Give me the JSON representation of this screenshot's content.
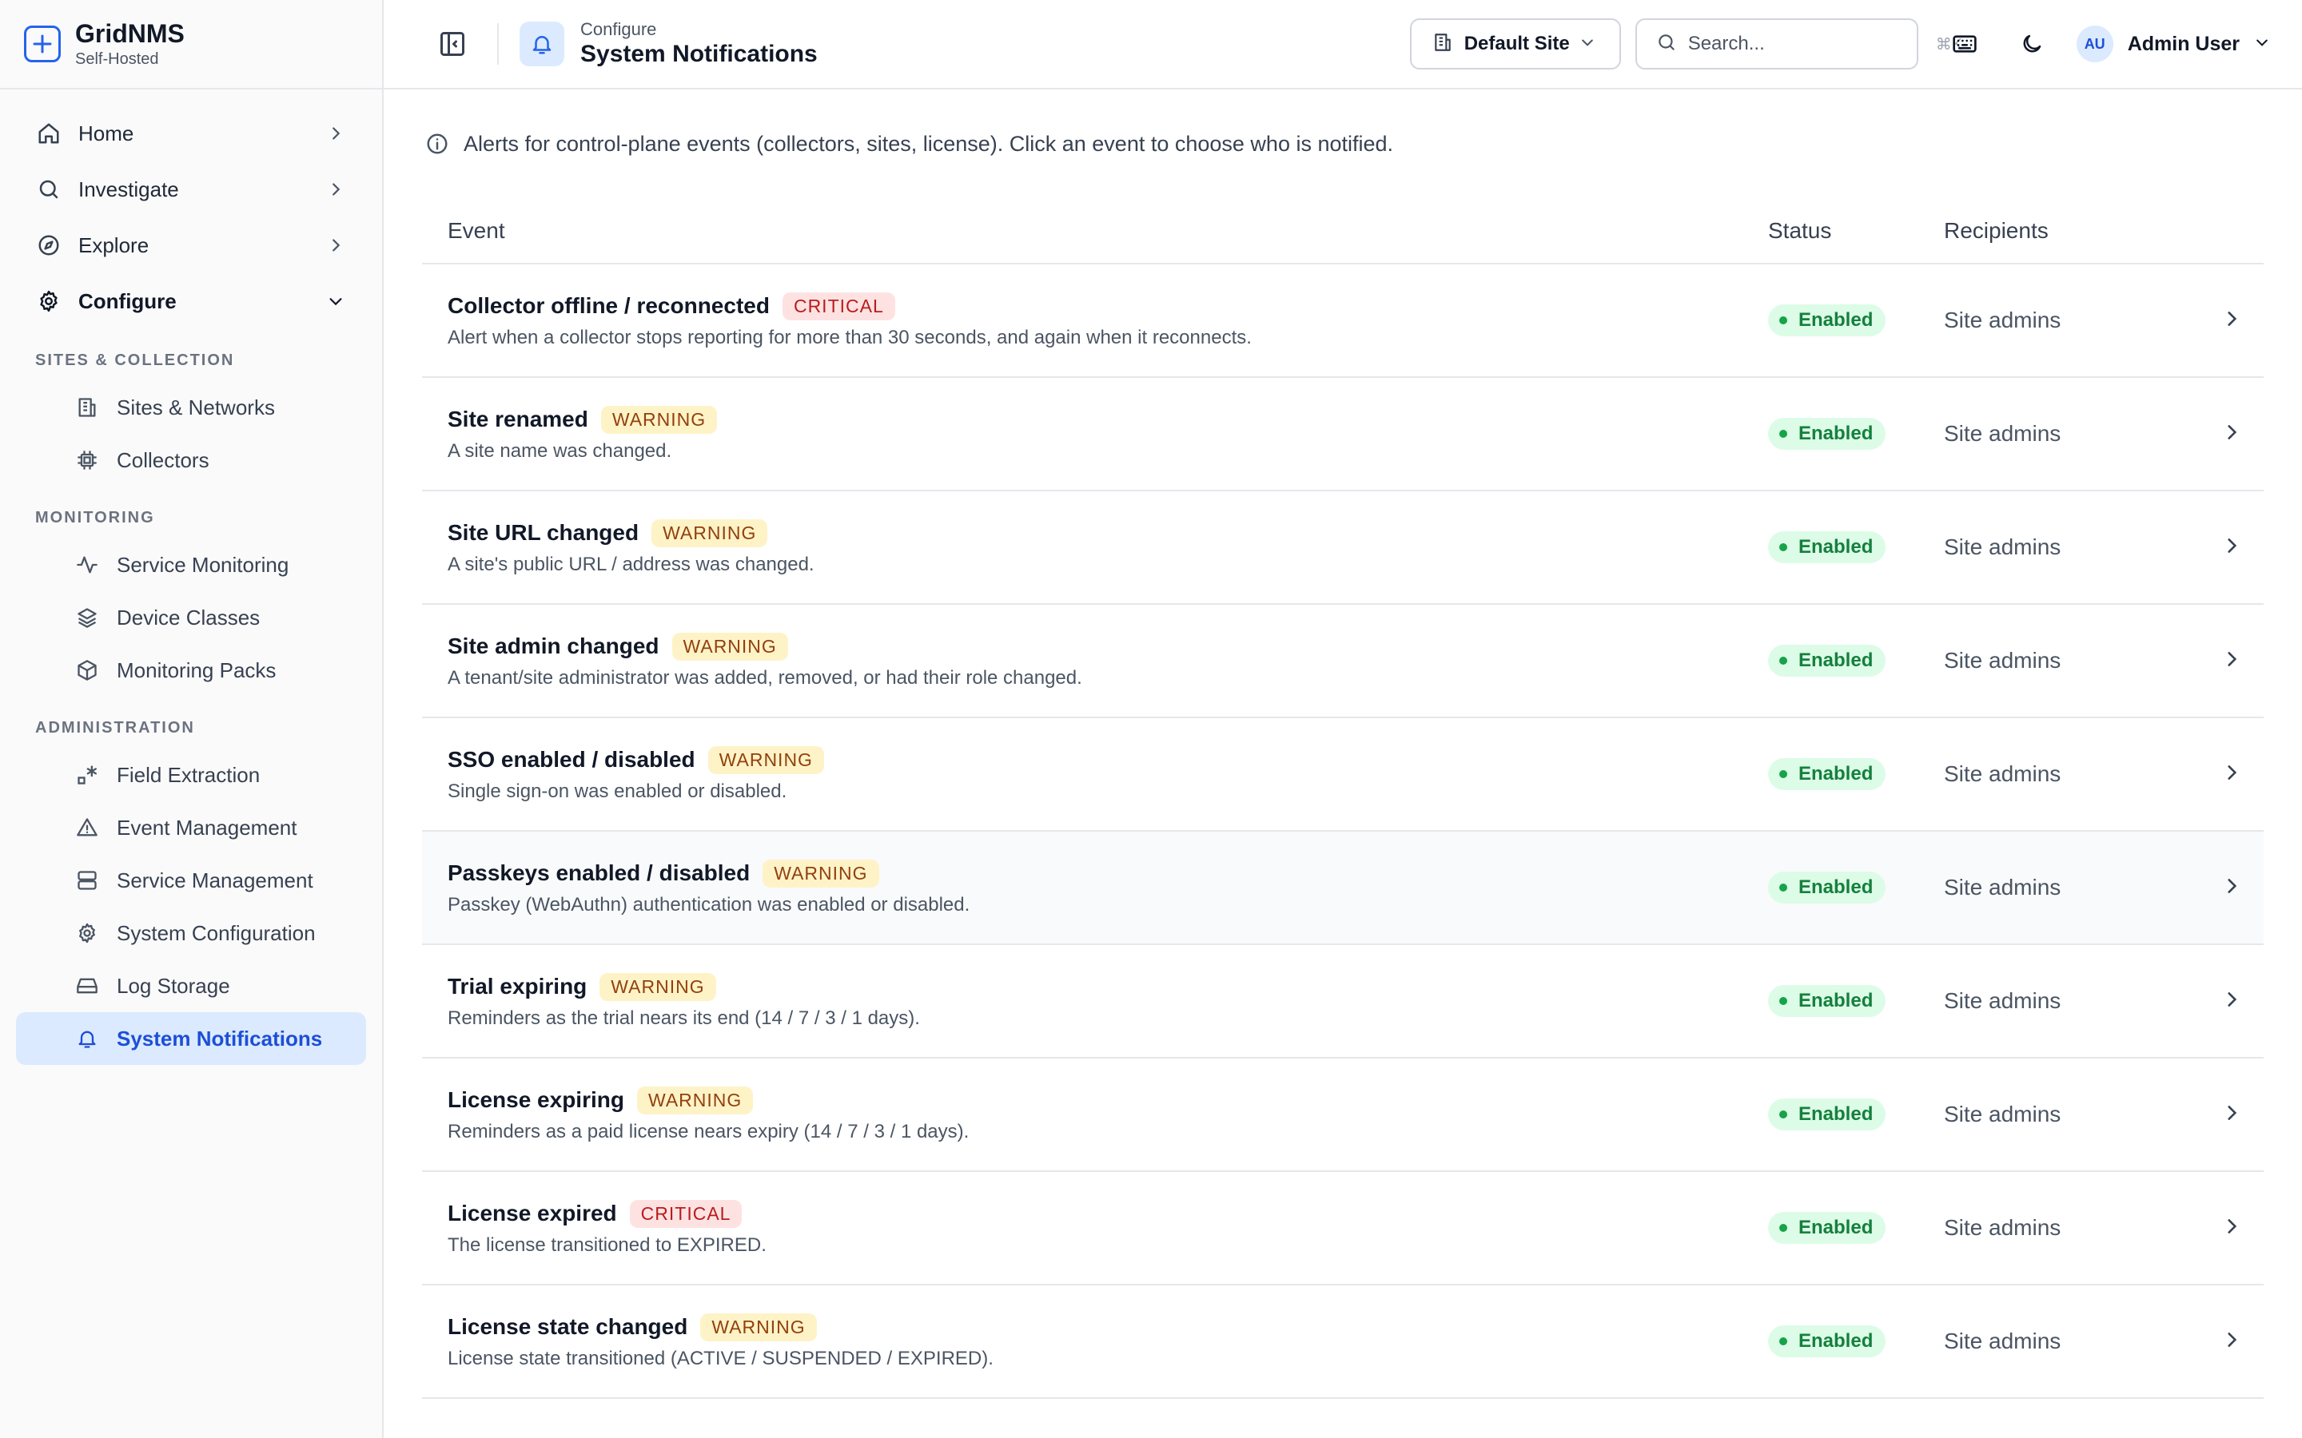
{
  "brand": {
    "name": "GridNMS",
    "sub": "Self-Hosted"
  },
  "sidebar": {
    "top": [
      {
        "label": "Home",
        "icon": "home-icon"
      },
      {
        "label": "Investigate",
        "icon": "search-icon"
      },
      {
        "label": "Explore",
        "icon": "compass-icon"
      },
      {
        "label": "Configure",
        "icon": "gear-icon"
      }
    ],
    "sections": [
      {
        "title": "SITES & COLLECTION",
        "items": [
          {
            "label": "Sites & Networks"
          },
          {
            "label": "Collectors"
          }
        ]
      },
      {
        "title": "MONITORING",
        "items": [
          {
            "label": "Service Monitoring"
          },
          {
            "label": "Device Classes"
          },
          {
            "label": "Monitoring Packs"
          }
        ]
      },
      {
        "title": "ADMINISTRATION",
        "items": [
          {
            "label": "Field Extraction"
          },
          {
            "label": "Event Management"
          },
          {
            "label": "Service Management"
          },
          {
            "label": "System Configuration"
          },
          {
            "label": "Log Storage"
          },
          {
            "label": "System Notifications"
          }
        ]
      }
    ]
  },
  "header": {
    "parent": "Configure",
    "title": "System Notifications",
    "site": "Default Site",
    "search_placeholder": "Search...",
    "search_shortcut": "⌘K",
    "avatar_initials": "AU",
    "user_name": "Admin User"
  },
  "info": "Alerts for control-plane events (collectors, sites, license). Click an event to choose who is notified.",
  "table": {
    "columns": {
      "event": "Event",
      "status": "Status",
      "recipients": "Recipients"
    },
    "rows": [
      {
        "name": "Collector offline / reconnected",
        "severity": "CRITICAL",
        "desc": "Alert when a collector stops reporting for more than 30 seconds, and again when it reconnects.",
        "status": "Enabled",
        "recipients": "Site admins"
      },
      {
        "name": "Site renamed",
        "severity": "WARNING",
        "desc": "A site name was changed.",
        "status": "Enabled",
        "recipients": "Site admins"
      },
      {
        "name": "Site URL changed",
        "severity": "WARNING",
        "desc": "A site's public URL / address was changed.",
        "status": "Enabled",
        "recipients": "Site admins"
      },
      {
        "name": "Site admin changed",
        "severity": "WARNING",
        "desc": "A tenant/site administrator was added, removed, or had their role changed.",
        "status": "Enabled",
        "recipients": "Site admins"
      },
      {
        "name": "SSO enabled / disabled",
        "severity": "WARNING",
        "desc": "Single sign-on was enabled or disabled.",
        "status": "Enabled",
        "recipients": "Site admins"
      },
      {
        "name": "Passkeys enabled / disabled",
        "severity": "WARNING",
        "desc": "Passkey (WebAuthn) authentication was enabled or disabled.",
        "status": "Enabled",
        "recipients": "Site admins"
      },
      {
        "name": "Trial expiring",
        "severity": "WARNING",
        "desc": "Reminders as the trial nears its end (14 / 7 / 3 / 1 days).",
        "status": "Enabled",
        "recipients": "Site admins"
      },
      {
        "name": "License expiring",
        "severity": "WARNING",
        "desc": "Reminders as a paid license nears expiry (14 / 7 / 3 / 1 days).",
        "status": "Enabled",
        "recipients": "Site admins"
      },
      {
        "name": "License expired",
        "severity": "CRITICAL",
        "desc": "The license transitioned to EXPIRED.",
        "status": "Enabled",
        "recipients": "Site admins"
      },
      {
        "name": "License state changed",
        "severity": "WARNING",
        "desc": "License state transitioned (ACTIVE / SUSPENDED / EXPIRED).",
        "status": "Enabled",
        "recipients": "Site admins"
      }
    ]
  },
  "colors": {
    "accent": "#2563eb",
    "active_bg": "#dbeafe",
    "critical": "#b91c1c",
    "warning": "#92400e",
    "enabled": "#15803d"
  }
}
